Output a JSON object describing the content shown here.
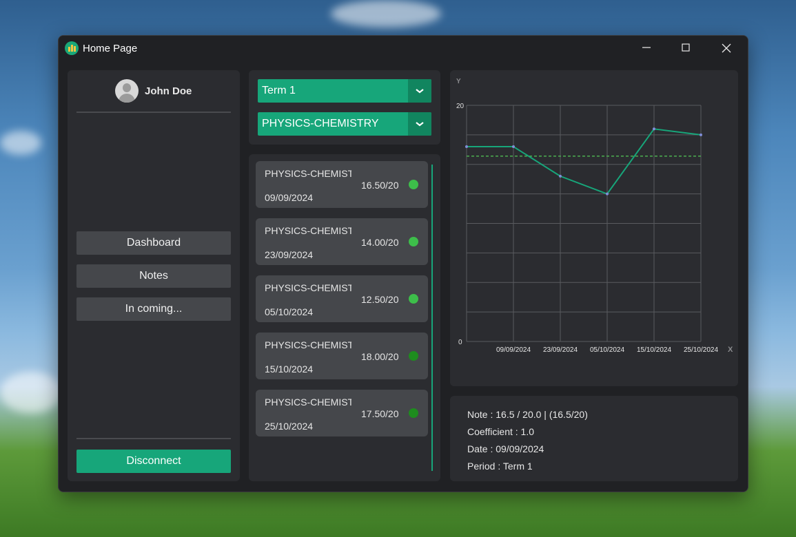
{
  "window": {
    "title": "Home Page"
  },
  "sidebar": {
    "username": "John Doe",
    "nav": [
      "Dashboard",
      "Notes",
      "In coming..."
    ],
    "disconnect": "Disconnect"
  },
  "filters": {
    "term": "Term 1",
    "subject": "PHYSICS-CHEMISTRY"
  },
  "grades": [
    {
      "subject": "PHYSICS-CHEMISTRY",
      "grade": "16.50/20",
      "date": "09/09/2024",
      "status_color": "#3dbe4a"
    },
    {
      "subject": "PHYSICS-CHEMISTRY",
      "grade": "14.00/20",
      "date": "23/09/2024",
      "status_color": "#3dbe4a"
    },
    {
      "subject": "PHYSICS-CHEMISTRY",
      "grade": "12.50/20",
      "date": "05/10/2024",
      "status_color": "#3dbe4a"
    },
    {
      "subject": "PHYSICS-CHEMISTRY",
      "grade": "18.00/20",
      "date": "15/10/2024",
      "status_color": "#1e8c1e"
    },
    {
      "subject": "PHYSICS-CHEMISTRY",
      "grade": "17.50/20",
      "date": "25/10/2024",
      "status_color": "#1e8c1e"
    }
  ],
  "details": {
    "note": "Note : 16.5 / 20.0 | (16.5/20)",
    "coefficient": "Coefficient : 1.0",
    "date": "Date : 09/09/2024",
    "period": "Period : Term 1"
  },
  "chart_data": {
    "type": "line",
    "x": [
      "09/09/2024",
      "23/09/2024",
      "05/10/2024",
      "15/10/2024",
      "25/10/2024"
    ],
    "series": [
      {
        "values": [
          16.5,
          16.5,
          14.0,
          12.5,
          18.0,
          17.5
        ]
      }
    ],
    "average": 15.7,
    "xlabel": "X",
    "ylabel": "Y",
    "ylim": [
      0,
      20
    ],
    "ytick_labels": [
      "0",
      "20"
    ],
    "grid": true,
    "line_color": "#17a67a",
    "average_color": "#4caf50"
  },
  "colors": {
    "accent": "#17a67a",
    "panel": "#2b2c30",
    "background": "#202124"
  }
}
